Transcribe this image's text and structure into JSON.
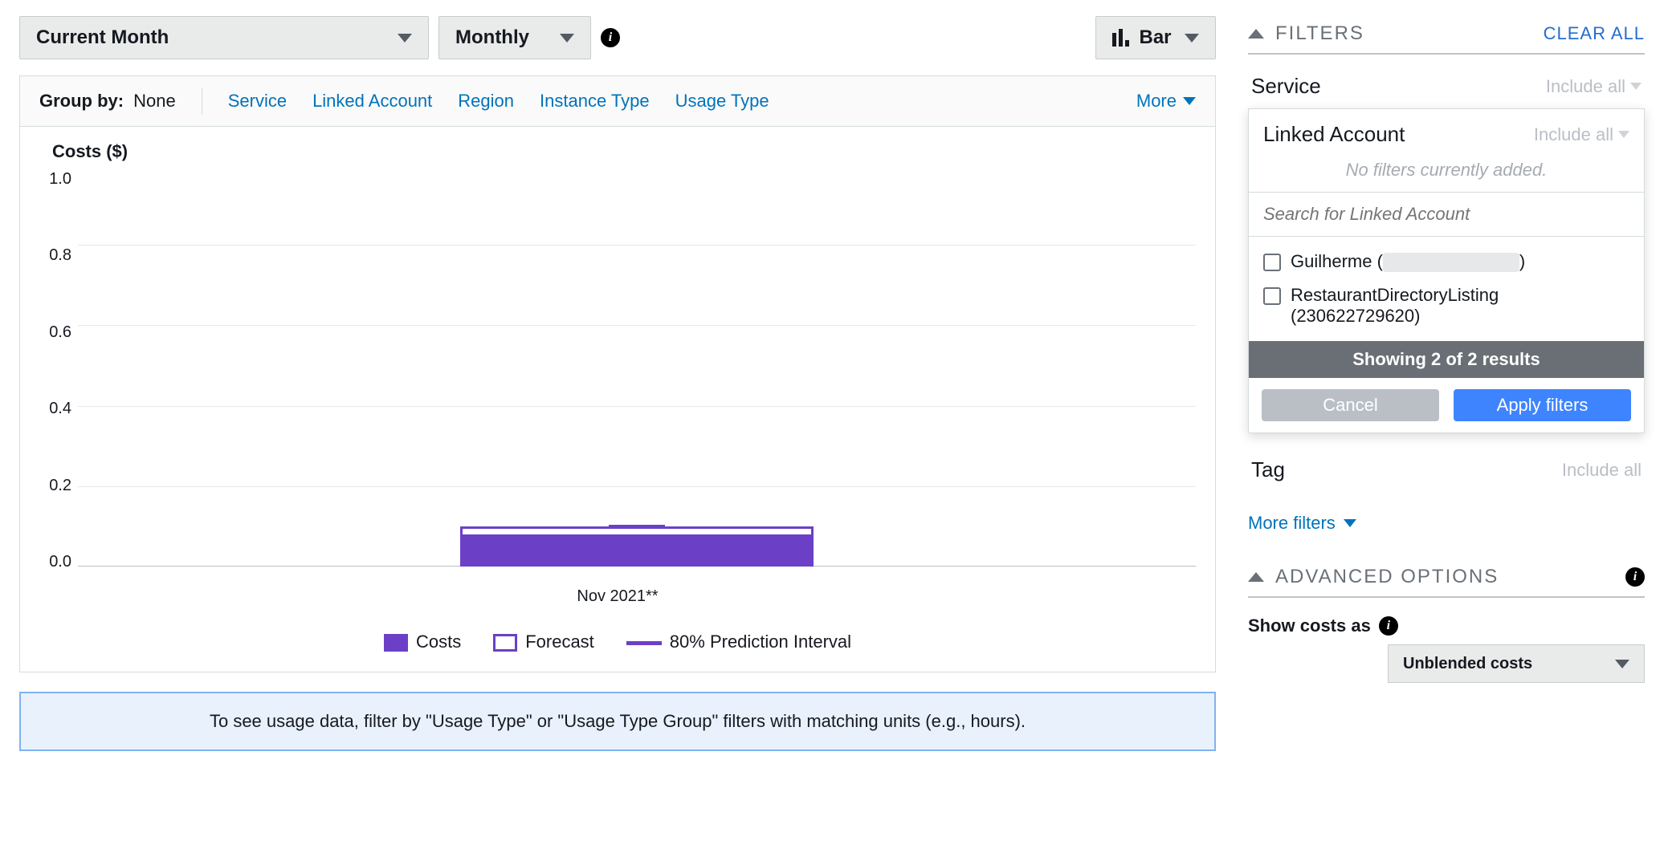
{
  "controls": {
    "range": "Current Month",
    "granularity": "Monthly",
    "chart_type": "Bar"
  },
  "groupby": {
    "label": "Group by:",
    "value": "None",
    "options": [
      "Service",
      "Linked Account",
      "Region",
      "Instance Type",
      "Usage Type"
    ],
    "more": "More"
  },
  "chart_data": {
    "type": "bar",
    "title": "Costs ($)",
    "ylim": [
      0,
      1.0
    ],
    "yticks": [
      "1.0",
      "0.8",
      "0.6",
      "0.4",
      "0.2",
      "0.0"
    ],
    "categories": [
      "Nov 2021**"
    ],
    "series": [
      {
        "name": "Costs",
        "values": [
          0.08
        ]
      },
      {
        "name": "Forecast",
        "values": [
          0.1
        ]
      }
    ],
    "prediction_interval_label": "80% Prediction Interval",
    "legend": [
      "Costs",
      "Forecast",
      "80% Prediction Interval"
    ]
  },
  "info_bar": "To see usage data, filter by \"Usage Type\" or \"Usage Type Group\" filters with matching units (e.g., hours).",
  "filters": {
    "section": "FILTERS",
    "clear": "CLEAR ALL",
    "service": {
      "label": "Service",
      "mode": "Include all"
    },
    "linked_account": {
      "label": "Linked Account",
      "mode": "Include all",
      "no_filters": "No filters currently added.",
      "search_placeholder": "Search for Linked Account",
      "options": [
        "Guilherme (",
        "RestaurantDirectoryListing (230622729620)"
      ],
      "options_tail_0": ")",
      "results": "Showing 2 of 2 results",
      "cancel": "Cancel",
      "apply": "Apply filters"
    },
    "tag": {
      "label": "Tag",
      "mode": "Include all"
    },
    "more": "More filters"
  },
  "advanced": {
    "section": "ADVANCED OPTIONS",
    "show_costs": "Show costs as",
    "unblended": "Unblended costs"
  }
}
